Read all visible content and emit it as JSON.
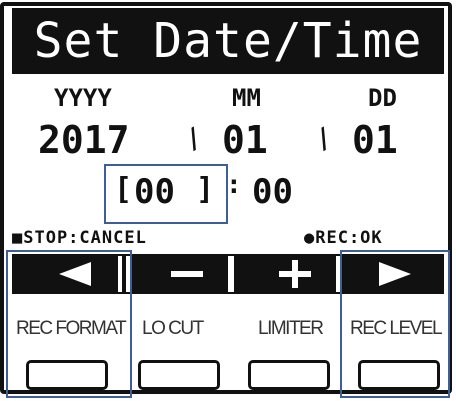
{
  "title": "Set Date/Time",
  "date": {
    "year_label": "YYYY",
    "month_label": "MM",
    "day_label": "DD",
    "year": "2017",
    "month": "01",
    "day": "01",
    "separator": "/"
  },
  "time": {
    "hour": "00",
    "minute": "00",
    "colon": ":"
  },
  "status": {
    "stop_hint": "■STOP:CANCEL",
    "rec_hint": "●REC:OK"
  },
  "buttons": [
    {
      "label": "REC FORMAT",
      "icon": "arrow-left-icon"
    },
    {
      "label": "LO CUT",
      "icon": "minus-icon"
    },
    {
      "label": "LIMITER",
      "icon": "plus-icon"
    },
    {
      "label": "REC LEVEL",
      "icon": "arrow-right-icon"
    }
  ],
  "colors": {
    "lcd_black": "#111111",
    "callout_blue": "#3e5e99"
  }
}
